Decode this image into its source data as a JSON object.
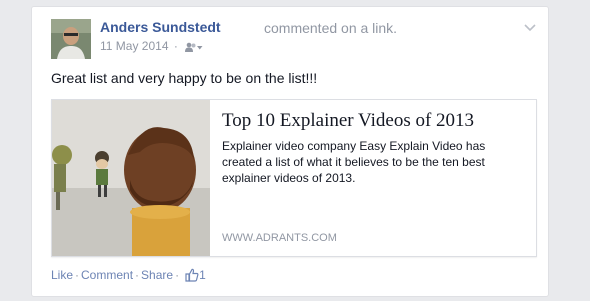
{
  "post": {
    "author": "Anders Sundstedt",
    "action": "commented on a link.",
    "date": "11 May 2014",
    "meta_separator": "·",
    "text": "Great list and very happy to be on the list!!!"
  },
  "link": {
    "title": "Top 10 Explainer Videos of 2013",
    "description": "Explainer video company Easy Explain Video has created a list of what it believes to be the ten best explainer videos of 2013.",
    "source": "WWW.ADRANTS.COM"
  },
  "footer": {
    "like_label": "Like",
    "comment_label": "Comment",
    "share_label": "Share",
    "separator": "·",
    "like_count": "1"
  },
  "icons": {
    "audience": "friends-icon",
    "options": "chevron-down-icon",
    "like": "thumbs-up-icon"
  },
  "colors": {
    "link_blue": "#3b5998",
    "muted": "#9197a3",
    "footer_link": "#6d84b4",
    "page_bg": "#e9eaed"
  }
}
